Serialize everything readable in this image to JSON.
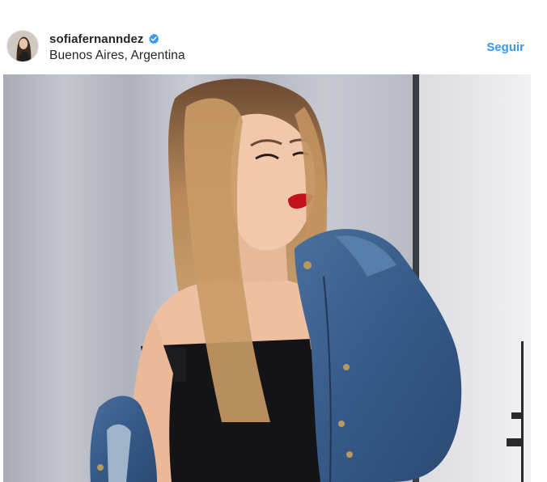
{
  "header": {
    "username": "sofiafernanndez",
    "verified": true,
    "location": "Buenos Aires, Argentina",
    "follow_label": "Seguir"
  },
  "colors": {
    "accent": "#3897f0",
    "text": "#262626",
    "verified_badge": "#3897f0"
  },
  "icons": {
    "verified": "verified-badge-icon",
    "avatar": "profile-avatar"
  }
}
